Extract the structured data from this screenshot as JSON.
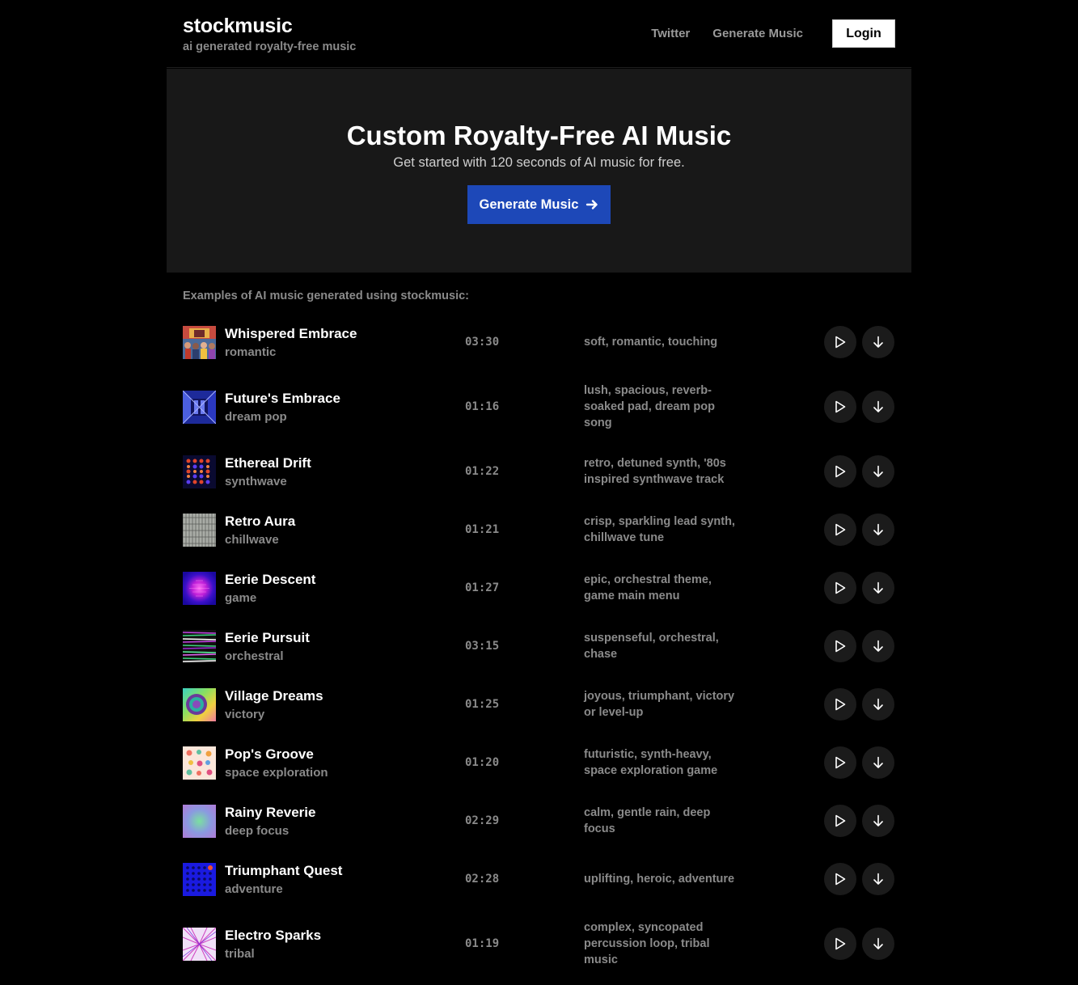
{
  "header": {
    "brand": "stockmusic",
    "tagline": "ai generated royalty-free music",
    "nav": {
      "twitter": "Twitter",
      "generate": "Generate Music",
      "login": "Login"
    }
  },
  "hero": {
    "title": "Custom Royalty-Free AI Music",
    "subtitle": "Get started with 120 seconds of AI music for free.",
    "cta": "Generate Music"
  },
  "examples_label": "Examples of AI music generated using stockmusic:",
  "tracks": [
    {
      "title": "Whispered Embrace",
      "genre": "romantic",
      "duration": "03:30",
      "tags": "soft, romantic, touching",
      "art": "art-photo-crowd"
    },
    {
      "title": "Future's Embrace",
      "genre": "dream pop",
      "duration": "01:16",
      "tags": "lush, spacious, reverb-soaked pad, dream pop song",
      "art": "art-blue-abstract"
    },
    {
      "title": "Ethereal Drift",
      "genre": "synthwave",
      "duration": "01:22",
      "tags": "retro, detuned synth, '80s inspired synthwave track",
      "art": "art-dot-grid"
    },
    {
      "title": "Retro Aura",
      "genre": "chillwave",
      "duration": "01:21",
      "tags": "crisp, sparkling lead synth, chillwave tune",
      "art": "art-grey-noise"
    },
    {
      "title": "Eerie Descent",
      "genre": "game",
      "duration": "01:27",
      "tags": "epic, orchestral theme, game main menu",
      "art": "art-purple-glow"
    },
    {
      "title": "Eerie Pursuit",
      "genre": "orchestral",
      "duration": "03:15",
      "tags": "suspenseful, orchestral, chase",
      "art": "art-glitch-lines"
    },
    {
      "title": "Village Dreams",
      "genre": "victory",
      "duration": "01:25",
      "tags": "joyous, triumphant, victory or level-up",
      "art": "art-rainbow-swirl"
    },
    {
      "title": "Pop's Groove",
      "genre": "space exploration",
      "duration": "01:20",
      "tags": "futuristic, synth-heavy, space exploration game",
      "art": "art-pastel-dots"
    },
    {
      "title": "Rainy Reverie",
      "genre": "deep focus",
      "duration": "02:29",
      "tags": "calm, gentle rain, deep focus",
      "art": "art-soft-gradient"
    },
    {
      "title": "Triumphant Quest",
      "genre": "adventure",
      "duration": "02:28",
      "tags": "uplifting, heroic, adventure",
      "art": "art-blue-dots"
    },
    {
      "title": "Electro Sparks",
      "genre": "tribal",
      "duration": "01:19",
      "tags": "complex, syncopated percussion loop, tribal music",
      "art": "art-pink-rays"
    }
  ]
}
